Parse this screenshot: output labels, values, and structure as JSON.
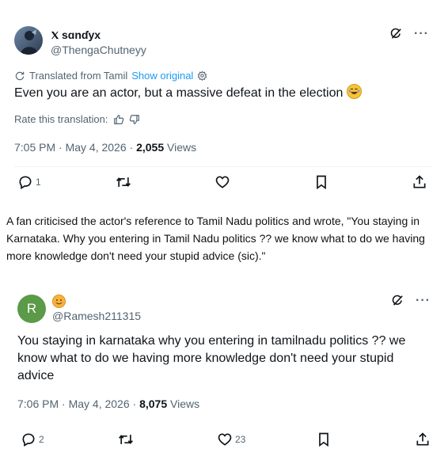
{
  "tweet1": {
    "display_name": "sɑnɗyx",
    "handle": "@ThengaChutneyy",
    "translated_label": "Translated from Tamil",
    "show_original": "Show original",
    "text": "Even you are an actor, but a massive defeat in the election",
    "rate_label": "Rate this translation:",
    "timestamp": "7:05 PM · May 4, 2026 · ",
    "views_count": "2,055",
    "views_label": " Views",
    "replies": "1",
    "reposts": "",
    "likes": ""
  },
  "article": {
    "paragraph": "A fan criticised the actor's reference to Tamil Nadu politics and wrote, \"You staying in Karnataka. Why you entering in Tamil Nadu politics ?? we know what to do we having more knowledge don't need your stupid advice (sic).\""
  },
  "tweet2": {
    "avatar_letter": "R",
    "handle": "@Ramesh211315",
    "text": "You staying in karnataka why you entering in tamilnadu politics ?? we know what to do we having  more knowledge don't need your stupid advice",
    "timestamp": "7:06 PM · May 4, 2026 · ",
    "views_count": "8,075",
    "views_label": " Views",
    "replies": "2",
    "reposts": "",
    "likes": "23"
  },
  "colors": {
    "link": "#1d9bf0",
    "secondary_text": "#536471",
    "primary_text": "#0f1419",
    "avatar_green": "#5b9a48"
  },
  "icons": [
    "x-logo-icon",
    "grok-icon",
    "more-icon",
    "translate-icon",
    "settings-icon",
    "thumbs-up-icon",
    "thumbs-down-icon",
    "reply-icon",
    "repost-icon",
    "like-icon",
    "bookmark-icon",
    "share-icon",
    "smiley-emoji-icon",
    "rofl-emoji-icon"
  ]
}
